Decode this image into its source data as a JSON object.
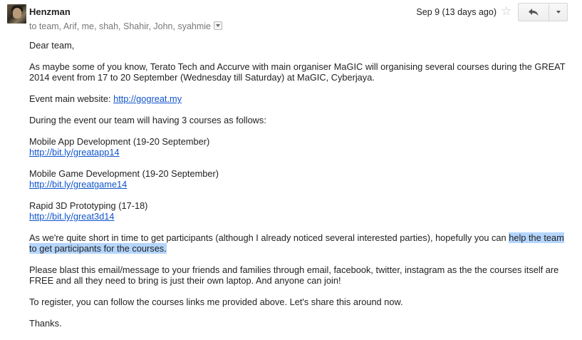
{
  "header": {
    "sender": "Henzman",
    "recipients": "to team, Arif, me, shah, Shahir, John, syahmie",
    "date": "Sep 9 (13 days ago)",
    "star_glyph": "☆",
    "icons": {
      "star": "star-icon",
      "reply": "reply-arrow-icon",
      "more": "chevron-down-icon",
      "toggle": "caret-down-icon"
    }
  },
  "body": {
    "greeting": "Dear team,",
    "intro": "As maybe some of you know, Terato Tech and Accurve with main organiser MaGIC will organising several courses during the GREAT 2014 event from 17 to 20 September (Wednesday till Saturday) at MaGIC, Cyberjaya.",
    "website_label": "Event main website: ",
    "website_link": "http://gogreat.my",
    "courses_intro": "During the event our team will having 3 courses as follows:",
    "courses": [
      {
        "title": "Mobile App Development (19-20 September)",
        "link": "http://bit.ly/greatapp14"
      },
      {
        "title": "Mobile Game Development (19-20 September)",
        "link": "http://bit.ly/greatgame14"
      },
      {
        "title": "Rapid 3D Prototyping (17-18)",
        "link": "http://bit.ly/great3d14"
      }
    ],
    "appeal_start": "As we're quite short in time to get participants (although I already noticed several interested parties), hopefully you can ",
    "appeal_highlight": "help the team to get participants for the courses.",
    "blast": "Please blast this email/message to your friends and families through email, facebook, twitter, instagram as the the courses itself are FREE and all they need to bring is just their own laptop. And anyone can join!",
    "register": "To register, you can follow the courses links me provided above. Let's share this around now.",
    "signoff": "Thanks."
  },
  "colors": {
    "link": "#1155cc",
    "highlight": "#b4d5fe",
    "secondary_text": "#777777"
  }
}
